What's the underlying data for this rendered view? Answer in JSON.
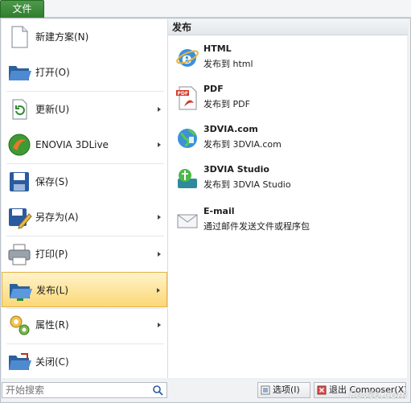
{
  "tab": {
    "label": "文件"
  },
  "left_menu": [
    {
      "label": "新建方案(N)",
      "icon": "new-project-icon",
      "submenu": false
    },
    {
      "label": "打开(O)",
      "icon": "open-folder-icon",
      "submenu": false
    },
    {
      "label": "更新(U)",
      "icon": "update-icon",
      "submenu": true
    },
    {
      "label": "ENOVIA 3DLive",
      "icon": "enovia-icon",
      "submenu": true
    },
    {
      "label": "保存(S)",
      "icon": "save-icon",
      "submenu": false
    },
    {
      "label": "另存为(A)",
      "icon": "save-as-icon",
      "submenu": true
    },
    {
      "label": "打印(P)",
      "icon": "print-icon",
      "submenu": true
    },
    {
      "label": "发布(L)",
      "icon": "publish-icon",
      "submenu": true,
      "active": true
    },
    {
      "label": "属性(R)",
      "icon": "properties-icon",
      "submenu": true
    },
    {
      "label": "关闭(C)",
      "icon": "close-icon",
      "submenu": false
    }
  ],
  "publish_panel": {
    "header": "发布",
    "items": [
      {
        "title": "HTML",
        "desc": "发布到 html",
        "icon": "internet-explorer-icon"
      },
      {
        "title": "PDF",
        "desc": "发布到 PDF",
        "icon": "pdf-icon"
      },
      {
        "title": "3DVIA.com",
        "desc": "发布到 3DVIA.com",
        "icon": "3dvia-globe-icon"
      },
      {
        "title": "3DVIA Studio",
        "desc": "发布到 3DVIA Studio",
        "icon": "3dvia-studio-icon"
      },
      {
        "title": "E-mail",
        "desc": "通过邮件发送文件或程序包",
        "icon": "envelope-icon"
      }
    ]
  },
  "search": {
    "placeholder": "开始搜索"
  },
  "bottom_buttons": [
    {
      "label": "选项(I)",
      "icon": "options-icon"
    },
    {
      "label": "退出 Composer(X)",
      "icon": "exit-icon"
    }
  ],
  "watermark": "Fevte.com",
  "colors": {
    "tab": "#2f7d2e",
    "active_item": "#fbd876",
    "accent_blue": "#1f5fa8"
  }
}
